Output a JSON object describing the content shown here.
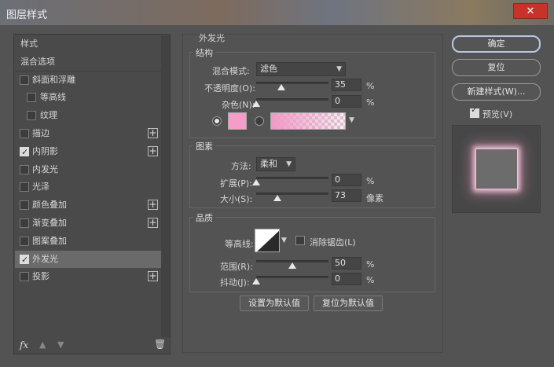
{
  "window": {
    "title": "图层样式",
    "close_glyph": "✕"
  },
  "styles_list": {
    "items": [
      {
        "label": "样式",
        "checkbox": false,
        "checked": false,
        "indent": false,
        "plus": false,
        "selected": false
      },
      {
        "label": "混合选项",
        "checkbox": false,
        "checked": false,
        "indent": false,
        "plus": false,
        "selected": false
      },
      {
        "label": "斜面和浮雕",
        "checkbox": true,
        "checked": false,
        "indent": false,
        "plus": false,
        "selected": false
      },
      {
        "label": "等高线",
        "checkbox": true,
        "checked": false,
        "indent": true,
        "plus": false,
        "selected": false
      },
      {
        "label": "纹理",
        "checkbox": true,
        "checked": false,
        "indent": true,
        "plus": false,
        "selected": false
      },
      {
        "label": "描边",
        "checkbox": true,
        "checked": false,
        "indent": false,
        "plus": true,
        "selected": false
      },
      {
        "label": "内阴影",
        "checkbox": true,
        "checked": true,
        "indent": false,
        "plus": true,
        "selected": false
      },
      {
        "label": "内发光",
        "checkbox": true,
        "checked": false,
        "indent": false,
        "plus": false,
        "selected": false
      },
      {
        "label": "光泽",
        "checkbox": true,
        "checked": false,
        "indent": false,
        "plus": false,
        "selected": false
      },
      {
        "label": "颜色叠加",
        "checkbox": true,
        "checked": false,
        "indent": false,
        "plus": true,
        "selected": false
      },
      {
        "label": "渐变叠加",
        "checkbox": true,
        "checked": false,
        "indent": false,
        "plus": true,
        "selected": false
      },
      {
        "label": "图案叠加",
        "checkbox": true,
        "checked": false,
        "indent": false,
        "plus": false,
        "selected": false
      },
      {
        "label": "外发光",
        "checkbox": true,
        "checked": true,
        "indent": false,
        "plus": false,
        "selected": true
      },
      {
        "label": "投影",
        "checkbox": true,
        "checked": false,
        "indent": false,
        "plus": true,
        "selected": false
      }
    ],
    "plus_glyph": "+",
    "footer": {
      "fx": "fx",
      "up": "▲",
      "down": "▼",
      "trash": "🗑"
    }
  },
  "outer_glow": {
    "section_title": "外发光",
    "structure": {
      "title": "结构",
      "blend_mode_label": "混合模式:",
      "blend_mode_value": "滤色",
      "opacity_label": "不透明度(O):",
      "opacity_value": "35",
      "opacity_fraction": 0.35,
      "noise_label": "杂色(N):",
      "noise_value": "0",
      "noise_fraction": 0,
      "percent": "%",
      "color_swatch": "#f69ccb",
      "color_mode": "solid"
    },
    "elements": {
      "title": "图素",
      "technique_label": "方法:",
      "technique_value": "柔和",
      "spread_label": "扩展(P):",
      "spread_value": "0",
      "spread_fraction": 0,
      "size_label": "大小(S):",
      "size_value": "73",
      "size_fraction": 0.29,
      "percent": "%",
      "pixels": "像素"
    },
    "quality": {
      "title": "品质",
      "contour_label": "等高线:",
      "antialias_label": "消除锯齿(L)",
      "antialias_checked": false,
      "range_label": "范围(R):",
      "range_value": "50",
      "range_fraction": 0.5,
      "jitter_label": "抖动(J):",
      "jitter_value": "0",
      "jitter_fraction": 0,
      "percent": "%"
    },
    "make_default_label": "设置为默认值",
    "reset_default_label": "复位为默认值"
  },
  "right_panel": {
    "ok_label": "确定",
    "reset_label": "复位",
    "new_style_label": "新建样式(W)...",
    "preview_label": "预览(V)",
    "preview_checked": true
  },
  "colors": {
    "dialog_bg": "#535353",
    "glow": "#f69ccb",
    "close_button": "#c7332b"
  }
}
